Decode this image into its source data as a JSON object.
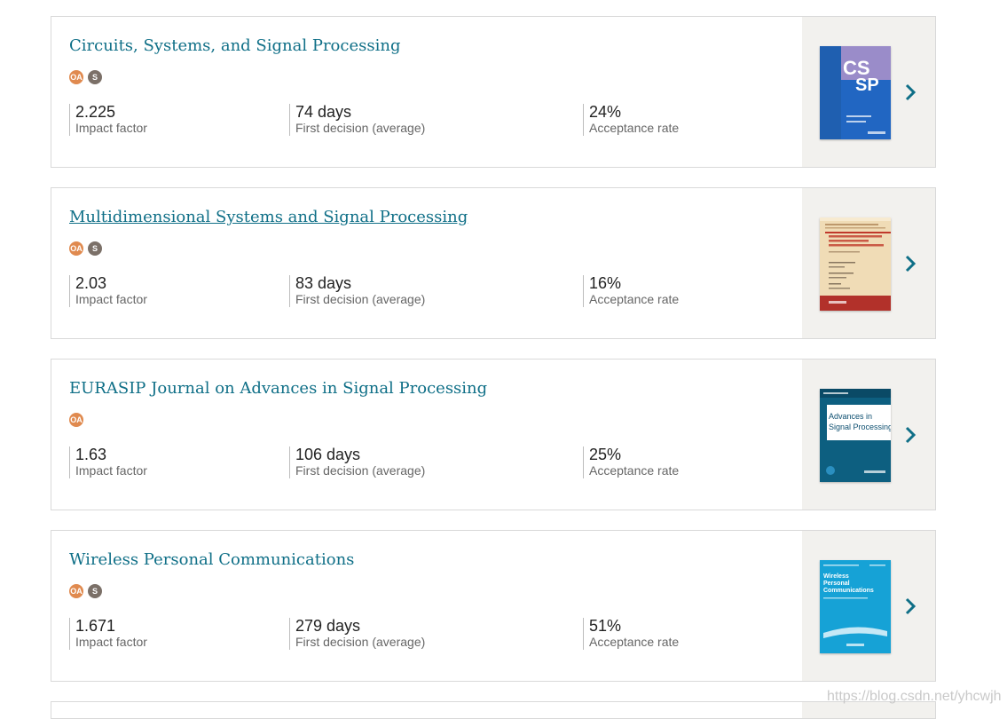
{
  "journals": [
    {
      "title": "Circuits, Systems, and Signal Processing",
      "badges": [
        "OA",
        "S"
      ],
      "impact_factor": "2.225",
      "impact_label": "Impact factor",
      "first_decision": "74 days",
      "first_decision_label": "First decision (average)",
      "acceptance": "24%",
      "acceptance_label": "Acceptance rate"
    },
    {
      "title": "Multidimensional Systems and Signal Processing",
      "badges": [
        "OA",
        "S"
      ],
      "impact_factor": "2.03",
      "impact_label": "Impact factor",
      "first_decision": "83 days",
      "first_decision_label": "First decision (average)",
      "acceptance": "16%",
      "acceptance_label": "Acceptance rate"
    },
    {
      "title": "EURASIP Journal on Advances in Signal Processing",
      "badges": [
        "OA"
      ],
      "impact_factor": "1.63",
      "impact_label": "Impact factor",
      "first_decision": "106 days",
      "first_decision_label": "First decision (average)",
      "acceptance": "25%",
      "acceptance_label": "Acceptance rate"
    },
    {
      "title": "Wireless Personal Communications",
      "badges": [
        "OA",
        "S"
      ],
      "impact_factor": "1.671",
      "impact_label": "Impact factor",
      "first_decision": "279 days",
      "first_decision_label": "First decision (average)",
      "acceptance": "51%",
      "acceptance_label": "Acceptance rate"
    }
  ],
  "badge_text": {
    "oa": "OA",
    "s": "S"
  },
  "covers": {
    "c1": {
      "big_text_1": "CS",
      "big_text_2": "SP"
    },
    "c3": {
      "line1": "Advances in",
      "line2": "Signal Processing"
    },
    "c4": {
      "line1": "Wireless",
      "line2": "Personal",
      "line3": "Communications"
    }
  },
  "watermark": "https://blog.csdn.net/yhcwjh",
  "colors": {
    "title_link": "#0f6f87",
    "badge_oa": "#e08a4f",
    "badge_s": "#7b7068",
    "side_panel": "#f2f1ee",
    "chevron": "#0f6f87"
  }
}
